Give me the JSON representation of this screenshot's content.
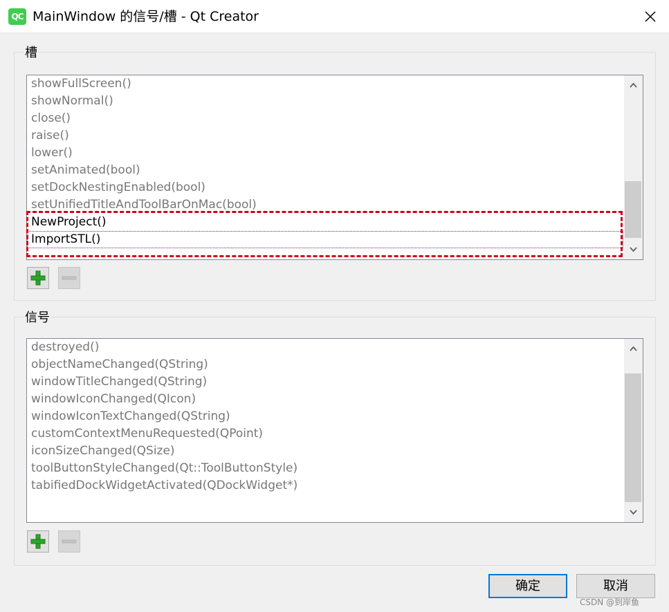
{
  "window": {
    "icon_text": "QC",
    "title": "MainWindow 的信号/槽 - Qt Creator"
  },
  "slots": {
    "title": "槽",
    "items": [
      "showFullScreen()",
      "showNormal()",
      "close()",
      "raise()",
      "lower()",
      "setAnimated(bool)",
      "setDockNestingEnabled(bool)",
      "setUnifiedTitleAndToolBarOnMac(bool)",
      "NewProject()",
      "ImportSTL()"
    ]
  },
  "signals": {
    "title": "信号",
    "items": [
      "destroyed()",
      "objectNameChanged(QString)",
      "windowTitleChanged(QString)",
      "windowIconChanged(QIcon)",
      "windowIconTextChanged(QString)",
      "customContextMenuRequested(QPoint)",
      "iconSizeChanged(QSize)",
      "toolButtonStyleChanged(Qt::ToolButtonStyle)",
      "tabifiedDockWidgetActivated(QDockWidget*)"
    ]
  },
  "buttons": {
    "ok": "确定",
    "cancel": "取消"
  },
  "watermark": "CSDN @到岸鱼",
  "colors": {
    "highlight": "#d0021b",
    "add_icon": "#2ea42e",
    "default_button_border": "#0078d7"
  }
}
